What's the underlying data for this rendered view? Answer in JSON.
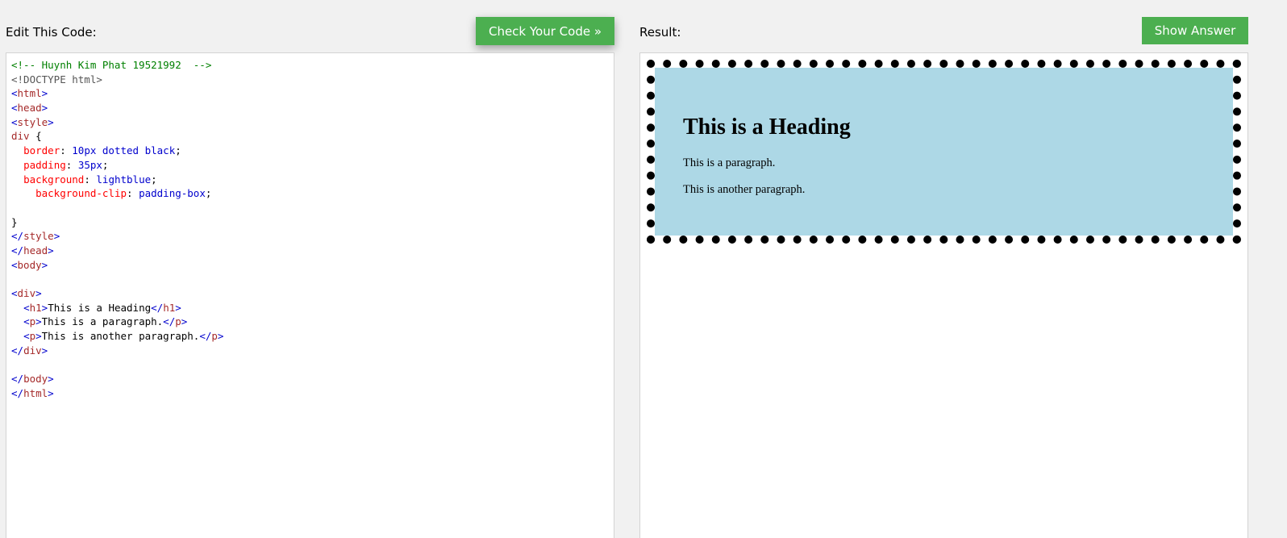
{
  "editor_panel": {
    "label": "Edit This Code:",
    "check_button": "Check Your Code »",
    "code_lines": [
      [
        {
          "t": "<!-- Huynh Kim Phat 19521992  -->",
          "c": "comment"
        }
      ],
      [
        {
          "t": "<!DOCTYPE html>",
          "c": "doctype"
        }
      ],
      [
        {
          "t": "<",
          "c": "bracket"
        },
        {
          "t": "html",
          "c": "tag"
        },
        {
          "t": ">",
          "c": "bracket"
        }
      ],
      [
        {
          "t": "<",
          "c": "bracket"
        },
        {
          "t": "head",
          "c": "tag"
        },
        {
          "t": ">",
          "c": "bracket"
        }
      ],
      [
        {
          "t": "<",
          "c": "bracket"
        },
        {
          "t": "style",
          "c": "tag"
        },
        {
          "t": ">",
          "c": "bracket"
        }
      ],
      [
        {
          "t": "div",
          "c": "tag"
        },
        {
          "t": " {",
          "c": "text"
        }
      ],
      [
        {
          "t": "  ",
          "c": "text"
        },
        {
          "t": "border",
          "c": "prop"
        },
        {
          "t": ": ",
          "c": "text"
        },
        {
          "t": "10px dotted black",
          "c": "val"
        },
        {
          "t": ";",
          "c": "text"
        }
      ],
      [
        {
          "t": "  ",
          "c": "text"
        },
        {
          "t": "padding",
          "c": "prop"
        },
        {
          "t": ": ",
          "c": "text"
        },
        {
          "t": "35px",
          "c": "val"
        },
        {
          "t": ";",
          "c": "text"
        }
      ],
      [
        {
          "t": "  ",
          "c": "text"
        },
        {
          "t": "background",
          "c": "prop"
        },
        {
          "t": ": ",
          "c": "text"
        },
        {
          "t": "lightblue",
          "c": "val"
        },
        {
          "t": ";",
          "c": "text"
        }
      ],
      [
        {
          "t": "    ",
          "c": "text"
        },
        {
          "t": "background-clip",
          "c": "prop"
        },
        {
          "t": ": ",
          "c": "text"
        },
        {
          "t": "padding-box",
          "c": "val"
        },
        {
          "t": ";",
          "c": "text"
        }
      ],
      [
        {
          "t": "",
          "c": "text"
        }
      ],
      [
        {
          "t": "}",
          "c": "text"
        }
      ],
      [
        {
          "t": "</",
          "c": "bracket"
        },
        {
          "t": "style",
          "c": "tag"
        },
        {
          "t": ">",
          "c": "bracket"
        }
      ],
      [
        {
          "t": "</",
          "c": "bracket"
        },
        {
          "t": "head",
          "c": "tag"
        },
        {
          "t": ">",
          "c": "bracket"
        }
      ],
      [
        {
          "t": "<",
          "c": "bracket"
        },
        {
          "t": "body",
          "c": "tag"
        },
        {
          "t": ">",
          "c": "bracket"
        }
      ],
      [
        {
          "t": "",
          "c": "text"
        }
      ],
      [
        {
          "t": "<",
          "c": "bracket"
        },
        {
          "t": "div",
          "c": "tag"
        },
        {
          "t": ">",
          "c": "bracket"
        }
      ],
      [
        {
          "t": "  ",
          "c": "text"
        },
        {
          "t": "<",
          "c": "bracket"
        },
        {
          "t": "h1",
          "c": "tag"
        },
        {
          "t": ">",
          "c": "bracket"
        },
        {
          "t": "This is a Heading",
          "c": "text"
        },
        {
          "t": "</",
          "c": "bracket"
        },
        {
          "t": "h1",
          "c": "tag"
        },
        {
          "t": ">",
          "c": "bracket"
        }
      ],
      [
        {
          "t": "  ",
          "c": "text"
        },
        {
          "t": "<",
          "c": "bracket"
        },
        {
          "t": "p",
          "c": "tag"
        },
        {
          "t": ">",
          "c": "bracket"
        },
        {
          "t": "This is a paragraph.",
          "c": "text"
        },
        {
          "t": "</",
          "c": "bracket"
        },
        {
          "t": "p",
          "c": "tag"
        },
        {
          "t": ">",
          "c": "bracket"
        }
      ],
      [
        {
          "t": "  ",
          "c": "text"
        },
        {
          "t": "<",
          "c": "bracket"
        },
        {
          "t": "p",
          "c": "tag"
        },
        {
          "t": ">",
          "c": "bracket"
        },
        {
          "t": "This is another paragraph.",
          "c": "text"
        },
        {
          "t": "</",
          "c": "bracket"
        },
        {
          "t": "p",
          "c": "tag"
        },
        {
          "t": ">",
          "c": "bracket"
        }
      ],
      [
        {
          "t": "</",
          "c": "bracket"
        },
        {
          "t": "div",
          "c": "tag"
        },
        {
          "t": ">",
          "c": "bracket"
        }
      ],
      [
        {
          "t": "",
          "c": "text"
        }
      ],
      [
        {
          "t": "</",
          "c": "bracket"
        },
        {
          "t": "body",
          "c": "tag"
        },
        {
          "t": ">",
          "c": "bracket"
        }
      ],
      [
        {
          "t": "</",
          "c": "bracket"
        },
        {
          "t": "html",
          "c": "tag"
        },
        {
          "t": ">",
          "c": "bracket"
        }
      ]
    ]
  },
  "result_panel": {
    "label": "Result:",
    "show_answer_button": "Show Answer",
    "demo": {
      "heading": "This is a Heading",
      "paragraph_1": "This is a paragraph.",
      "paragraph_2": "This is another paragraph."
    }
  },
  "colors": {
    "button_green": "#4caf50",
    "demo_background": "lightblue"
  }
}
